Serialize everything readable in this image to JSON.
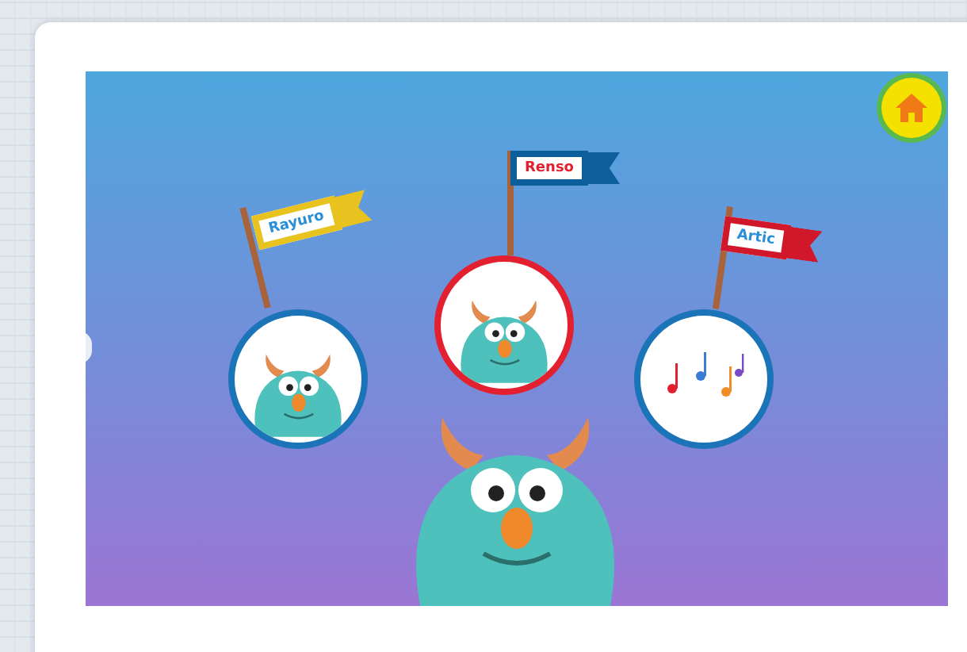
{
  "levels": [
    {
      "kind": "monster",
      "flag": "Rayuro",
      "color": "#e8c21e",
      "selected": false
    },
    {
      "kind": "monster",
      "flag": "Renso",
      "color": "#0d5f9c",
      "selected": true
    },
    {
      "kind": "music",
      "flag": "Artic",
      "color": "#d0182a",
      "selected": false
    }
  ]
}
